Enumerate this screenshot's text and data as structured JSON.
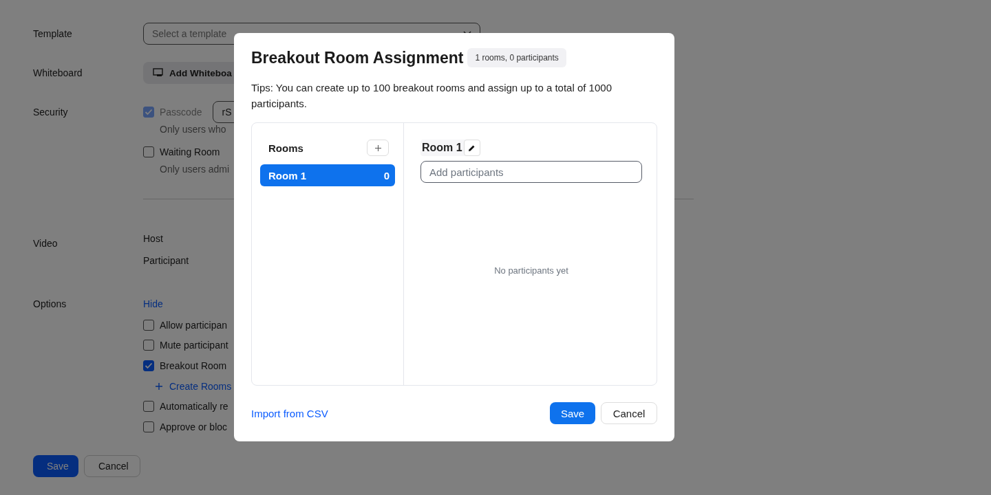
{
  "form": {
    "template": {
      "label": "Template",
      "placeholder": "Select a template"
    },
    "whiteboard": {
      "label": "Whiteboard",
      "button": "Add Whiteboa"
    },
    "security": {
      "label": "Security",
      "options": [
        {
          "label": "Passcode",
          "checked": true,
          "disabled": true,
          "value": "rS",
          "note": "Only users who"
        },
        {
          "label": "Waiting Room",
          "checked": false,
          "disabled": false,
          "note": "Only users admi"
        }
      ]
    },
    "video": {
      "label": "Video",
      "items": [
        "Host",
        "Participant"
      ]
    },
    "options": {
      "label": "Options",
      "toggle": "Hide",
      "items": [
        {
          "kind": "checkbox",
          "label": "Allow participan",
          "checked": false
        },
        {
          "kind": "checkbox",
          "label": "Mute participant",
          "checked": false
        },
        {
          "kind": "checkbox",
          "label": "Breakout Room",
          "checked": true
        },
        {
          "kind": "link",
          "label": "Create Rooms"
        },
        {
          "kind": "checkbox",
          "label": "Automatically re",
          "checked": false
        },
        {
          "kind": "checkbox",
          "label": "Approve or bloc",
          "checked": false
        }
      ]
    },
    "buttons": [
      "Save",
      "Cancel"
    ]
  },
  "dialog": {
    "title": "Breakout Room Assignment",
    "badge": "1 rooms, 0 participants",
    "tips": "Tips: You can create up to 100 breakout rooms and assign up to a total of 1000 participants.",
    "rooms_heading": "Rooms",
    "rooms": [
      {
        "name": "Room 1",
        "count": "0",
        "selected": true
      }
    ],
    "room_title": "Room 1",
    "search": {
      "placeholder": "Add participants"
    },
    "empty": "No participants yet",
    "import_link": "Import from CSV",
    "buttons": [
      "Save",
      "Cancel"
    ]
  }
}
